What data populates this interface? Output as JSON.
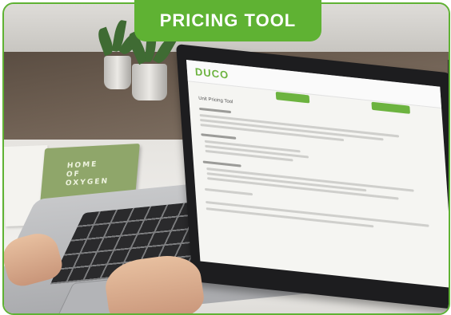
{
  "banner": {
    "label": "PRICING TOOL"
  },
  "screen": {
    "logo": "DUCO",
    "title": "Unit Pricing Tool"
  },
  "booklet": {
    "text": "HOME\nOF\nOXYGEN"
  },
  "colors": {
    "accent": "#5fb233"
  }
}
